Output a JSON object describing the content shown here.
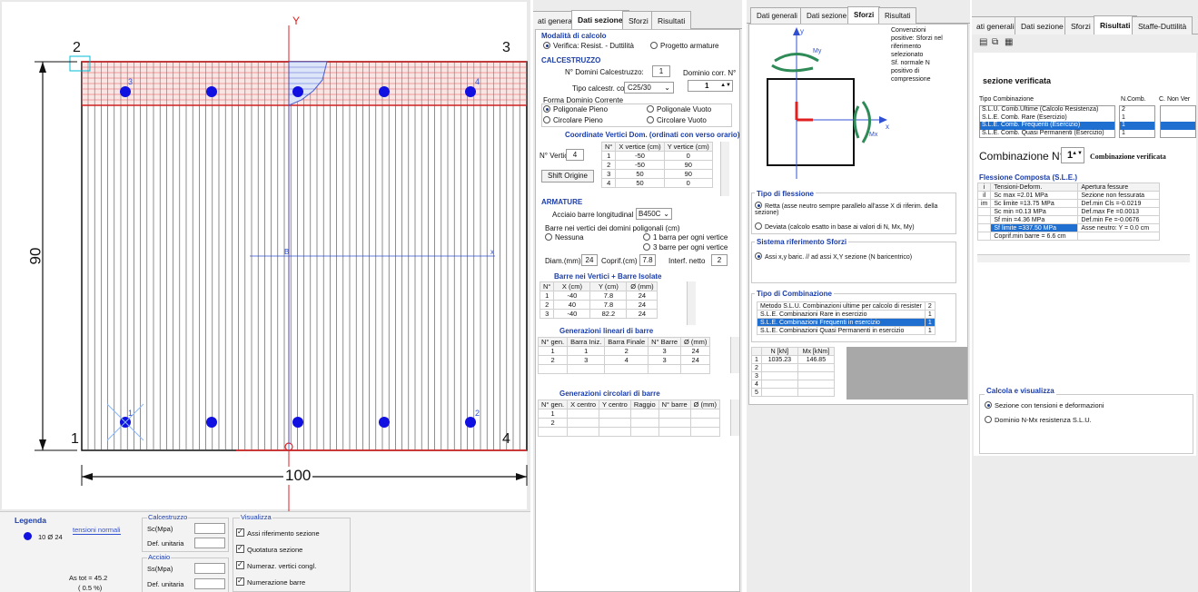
{
  "section": {
    "y_axis_label": "Y",
    "x_axis_label": "x",
    "b_label": "B",
    "height_dim": "90",
    "width_dim": "100",
    "corners": [
      "1",
      "2",
      "3",
      "4"
    ],
    "bar_nums": [
      "1",
      "2",
      "3",
      "4"
    ]
  },
  "legend": {
    "title": "Legenda",
    "bars_text": "10 Ø 24",
    "tension_label": "tensioni normali",
    "as_tot": "As tot = 45.2",
    "as_pct": "( 0.5 %)"
  },
  "calcestruzzo_box": {
    "title": "Calcestruzzo",
    "sc": "Sc(Mpa)",
    "def": "Def. unitaria"
  },
  "acciaio_box": {
    "title": "Acciaio",
    "ss": "Ss(Mpa)",
    "def": "Def. unitaria"
  },
  "visualizza": {
    "title": "Visualizza",
    "items": [
      "Assi riferimento sezione",
      "Quotatura sezione",
      "Numeraz. vertici congl.",
      "Numerazione barre"
    ]
  },
  "panel2": {
    "tabs": [
      "ati generali",
      "Dati sezione",
      "Sforzi",
      "Risultati"
    ],
    "modalita_title": "Modalità di calcolo",
    "verifica": "Verifica: Resist. - Duttilità",
    "progetto": "Progetto armature",
    "cls_title": "CALCESTRUZZO",
    "n_domini_label": "N° Domini Calcestruzzo:",
    "n_domini_value": "1",
    "dominio_corr_label": "Dominio corr. N°",
    "dominio_corr_value": "1",
    "tipo_cls_label": "Tipo calcestr. con:",
    "tipo_cls_value": "C25/30",
    "forma_label": "Forma Dominio Corrente",
    "forme": [
      "Poligonale Pieno",
      "Poligonale Vuoto",
      "Circolare Pieno",
      "Circolare Vuoto"
    ],
    "coord_title": "Coordinate Vertici Dom. (ordinati con verso orario)",
    "n_vertici_label": "N° Vertici",
    "n_vertici_value": "4",
    "shift_btn": "Shift Origine",
    "vert_headers": [
      "N°",
      "X vertice (cm)",
      "Y vertice (cm)"
    ],
    "vert_rows": [
      [
        "1",
        "-50",
        "0"
      ],
      [
        "2",
        "-50",
        "90"
      ],
      [
        "3",
        "50",
        "90"
      ],
      [
        "4",
        "50",
        "0"
      ]
    ],
    "arm_title": "ARMATURE",
    "acciaio_label": "Acciaio barre longitudinal",
    "acciaio_value": "B450C",
    "barre_vertici_label": "Barre nei vertici dei domini poligonali (cm)",
    "nessuna": "Nessuna",
    "una_barra": "1 barra per ogni vertice",
    "tre_barre": "3 barre per ogni vertice",
    "diam_label": "Diam.(mm)",
    "diam_value": "24",
    "coprif_label": "Coprif.(cm)",
    "coprif_value": "7.8",
    "interf_label": "Interf. netto",
    "interf_value": "2",
    "barre_title": "Barre nei Vertici + Barre Isolate",
    "barre_headers": [
      "N°",
      "X (cm)",
      "Y (cm)",
      "Ø (mm)"
    ],
    "barre_rows": [
      [
        "1",
        "-40",
        "7.8",
        "24"
      ],
      [
        "2",
        "40",
        "7.8",
        "24"
      ],
      [
        "3",
        "-40",
        "82.2",
        "24"
      ]
    ],
    "gen_lin_title": "Generazioni lineari di barre",
    "gen_lin_headers": [
      "N° gen.",
      "Barra Iniz.",
      "Barra Finale",
      "N° Barre",
      "Ø (mm)"
    ],
    "gen_lin_rows": [
      [
        "1",
        "1",
        "2",
        "3",
        "24"
      ],
      [
        "2",
        "3",
        "4",
        "3",
        "24"
      ]
    ],
    "gen_circ_title": "Generazioni circolari di barre",
    "gen_circ_headers": [
      "N° gen.",
      "X centro",
      "Y centro",
      "Raggio",
      "N° barre",
      "Ø (mm)"
    ],
    "gen_circ_rows": [
      [
        "1"
      ],
      [
        "2"
      ]
    ]
  },
  "panel3": {
    "tabs": [
      "Dati generali",
      "Dati sezione",
      "Sforzi",
      "Risultati"
    ],
    "conv_text": [
      "Convenzioni",
      "positive: Sforzi nel",
      "riferimento",
      "selezionato",
      "Sf. normale N",
      "positivo di",
      "compressione"
    ],
    "tipo_fless_title": "Tipo di flessione",
    "retta": "Retta (asse neutro sempre parallelo all'asse X di riferim. della sezione)",
    "deviata": "Deviata (calcolo esatto in base ai valori di N, Mx, My)",
    "sist_title": "Sistema riferimento Sforzi",
    "assi": "Assi x,y baric. // ad assi X,Y sezione (N baricentrico)",
    "comb_title": "Tipo di Combinazione",
    "comb_rows": [
      [
        "Metodo S.L.U. Combinazioni ultime per calcolo di resister",
        "2"
      ],
      [
        "S.L.E. Combinazioni Rare in esercizio",
        "1"
      ],
      [
        "S.L.E. Combinazioni Frequenti in esercizio",
        "1"
      ],
      [
        "S.L.E. Combinazioni Quasi Permanenti in esercizio",
        "1"
      ]
    ],
    "forces_headers": [
      "",
      "N [kN]",
      "Mx [kNm]"
    ],
    "forces_rows": [
      [
        "1",
        "1035.23",
        "146.85"
      ],
      [
        "2",
        "",
        ""
      ],
      [
        "3",
        "",
        ""
      ],
      [
        "4",
        "",
        ""
      ],
      [
        "5",
        "",
        ""
      ]
    ],
    "diagram_labels": {
      "y": "y",
      "x": "x",
      "mx": "Mx",
      "my": "My"
    }
  },
  "panel4": {
    "tabs": [
      "ati generali",
      "Dati sezione",
      "Sforzi",
      "Risultati",
      "Staffe-Duttilità"
    ],
    "verificata": "sezione verificata",
    "tipo_comb_label": "Tipo  Combinazione",
    "ncomb_label": "N.Comb.",
    "cnonver_label": "C. Non Ver",
    "comb_rows": [
      [
        "S.L.U. Comb.Ultime (Calcolo Resistenza)",
        "2"
      ],
      [
        "S.L.E. Comb. Rare (Esercizio)",
        "1"
      ],
      [
        "S.L.E. Comb. Frequenti (Esercizio)",
        "1"
      ],
      [
        "S.L.E. Comb. Quasi Permanenti (Esercizio)",
        "1"
      ]
    ],
    "combinazione_label": "Combinazione N°",
    "combinazione_value": "1",
    "comb_verificata": "Combinazione verificata",
    "fless_title": "Flessione Composta (S.L.E.)",
    "tens_headers": [
      "i",
      "Tensioni-Deform.",
      "Apertura fessure"
    ],
    "tens_rows": [
      [
        "il",
        "Sc max =2.01 MPa",
        "Sezione non fessurata"
      ],
      [
        "im",
        "Sc limite =13.75 MPa",
        "Def.min Cls =-0.0219"
      ],
      [
        "",
        "Sc min =0.13 MPa",
        "Def.max Fe  =0.0013"
      ],
      [
        "",
        "Sf min   =4.36 MPa",
        "Def.min Fe  =-0.0676"
      ],
      [
        "",
        "Sf limite =337.50 MPa",
        "Asse neutro: Y = 0.0 cm"
      ],
      [
        "",
        "Coprif.min  barre = 6.6 cm",
        ""
      ]
    ],
    "calcola_title": "Calcola e visualizza",
    "opt1": "Sezione con tensioni e deformazioni",
    "opt2": "Dominio N-Mx resistenza S.L.U."
  }
}
